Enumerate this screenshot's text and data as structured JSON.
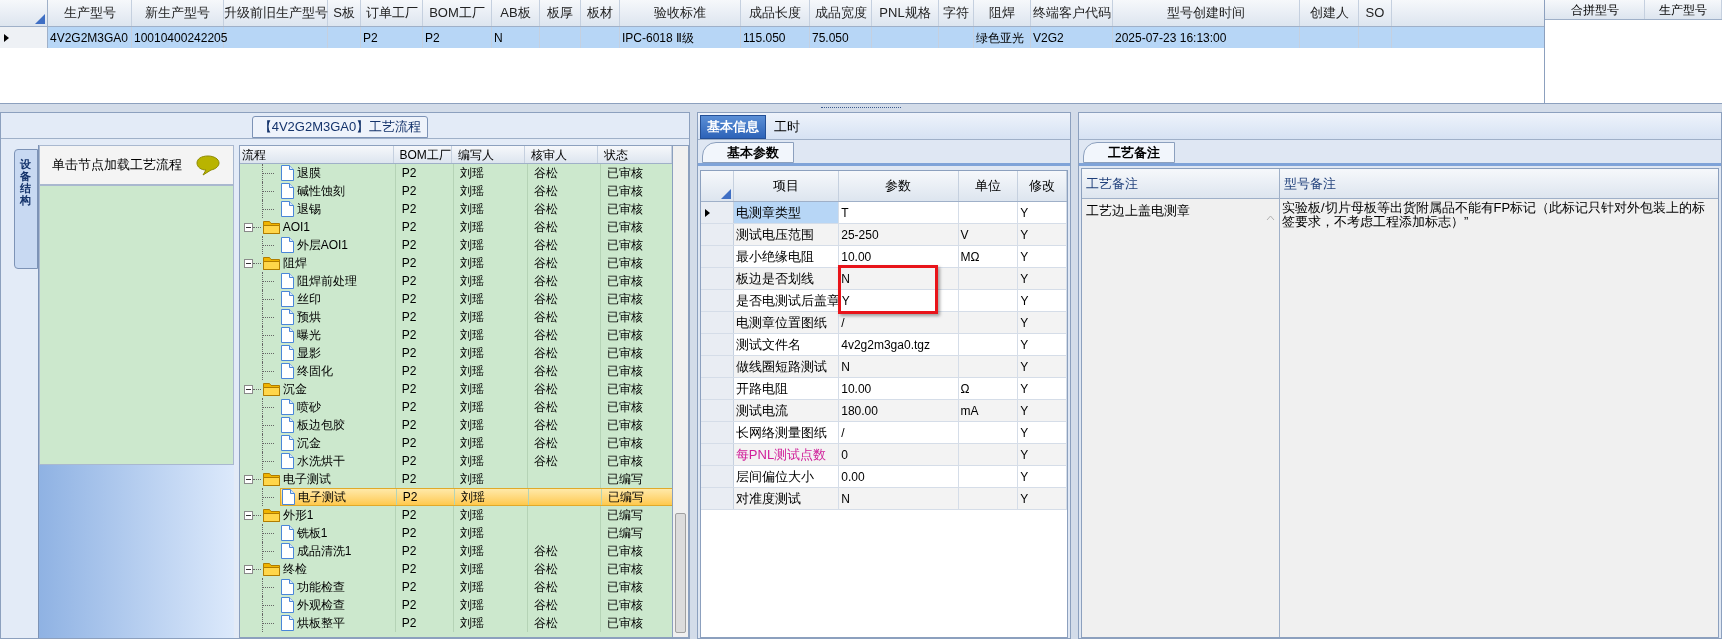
{
  "main_grid": {
    "columns": [
      "生产型号",
      "新生产型号",
      "升级前旧生产型号",
      "S板",
      "订单工厂",
      "BOM工厂",
      "AB板",
      "板厚",
      "板材",
      "验收标准",
      "成品长度",
      "成品宽度",
      "PNL规格",
      "字符",
      "阻焊",
      "终端客户代码",
      "型号创建时间",
      "创建人",
      "SO"
    ],
    "rows": [
      {
        "selected": true,
        "cells": [
          "4V2G2M3GA0",
          "10010400242205",
          null,
          null,
          "P2",
          "P2",
          "N",
          null,
          null,
          "IPC-6018 Ⅱ级",
          "115.050",
          "75.050",
          null,
          null,
          "绿色亚光",
          "V2G2",
          "2025-07-23 16:13:00",
          null,
          null
        ]
      }
    ]
  },
  "merge_grid": {
    "columns": [
      "合拼型号",
      "生产型号"
    ]
  },
  "process_panel": {
    "title": "【4V2G2M3GA0】工艺流程",
    "side_tab": "设备结构",
    "hint": "单击节点加载工艺流程",
    "columns": [
      "流程",
      "BOM工厂",
      "编写人",
      "核审人",
      "状态"
    ],
    "tree": [
      {
        "kind": "step",
        "name": "退膜",
        "bom": "P2",
        "author": "刘瑶",
        "reviewer": "谷松",
        "status": "已审核",
        "selected": false
      },
      {
        "kind": "step",
        "name": "碱性蚀刻",
        "bom": "P2",
        "author": "刘瑶",
        "reviewer": "谷松",
        "status": "已审核",
        "selected": false
      },
      {
        "kind": "step",
        "name": "退锡",
        "bom": "P2",
        "author": "刘瑶",
        "reviewer": "谷松",
        "status": "已审核",
        "selected": false
      },
      {
        "kind": "folder",
        "expanded": true,
        "name": "AOI1",
        "bom": "P2",
        "author": "刘瑶",
        "reviewer": "谷松",
        "status": "已审核",
        "selected": false,
        "children": [
          {
            "kind": "step",
            "name": "外层AOI1",
            "bom": "P2",
            "author": "刘瑶",
            "reviewer": "谷松",
            "status": "已审核",
            "selected": false
          }
        ]
      },
      {
        "kind": "folder",
        "expanded": true,
        "name": "阻焊",
        "bom": "P2",
        "author": "刘瑶",
        "reviewer": "谷松",
        "status": "已审核",
        "selected": false,
        "children": [
          {
            "kind": "step",
            "name": "阻焊前处理",
            "bom": "P2",
            "author": "刘瑶",
            "reviewer": "谷松",
            "status": "已审核",
            "selected": false
          },
          {
            "kind": "step",
            "name": "丝印",
            "bom": "P2",
            "author": "刘瑶",
            "reviewer": "谷松",
            "status": "已审核",
            "selected": false
          },
          {
            "kind": "step",
            "name": "预烘",
            "bom": "P2",
            "author": "刘瑶",
            "reviewer": "谷松",
            "status": "已审核",
            "selected": false
          },
          {
            "kind": "step",
            "name": "曝光",
            "bom": "P2",
            "author": "刘瑶",
            "reviewer": "谷松",
            "status": "已审核",
            "selected": false
          },
          {
            "kind": "step",
            "name": "显影",
            "bom": "P2",
            "author": "刘瑶",
            "reviewer": "谷松",
            "status": "已审核",
            "selected": false
          },
          {
            "kind": "step",
            "name": "终固化",
            "bom": "P2",
            "author": "刘瑶",
            "reviewer": "谷松",
            "status": "已审核",
            "selected": false
          }
        ]
      },
      {
        "kind": "folder",
        "expanded": true,
        "name": "沉金",
        "bom": "P2",
        "author": "刘瑶",
        "reviewer": "谷松",
        "status": "已审核",
        "selected": false,
        "children": [
          {
            "kind": "step",
            "name": "喷砂",
            "bom": "P2",
            "author": "刘瑶",
            "reviewer": "谷松",
            "status": "已审核",
            "selected": false
          },
          {
            "kind": "step",
            "name": "板边包胶",
            "bom": "P2",
            "author": "刘瑶",
            "reviewer": "谷松",
            "status": "已审核",
            "selected": false
          },
          {
            "kind": "step",
            "name": "沉金",
            "bom": "P2",
            "author": "刘瑶",
            "reviewer": "谷松",
            "status": "已审核",
            "selected": false
          },
          {
            "kind": "step",
            "name": "水洗烘干",
            "bom": "P2",
            "author": "刘瑶",
            "reviewer": "谷松",
            "status": "已审核",
            "selected": false
          }
        ]
      },
      {
        "kind": "folder",
        "expanded": true,
        "name": "电子测试",
        "bom": "P2",
        "author": "刘瑶",
        "status": "已编写",
        "selected": false,
        "children": [
          {
            "kind": "step",
            "name": "电子测试",
            "bom": "P2",
            "author": "刘瑶",
            "status": "已编写",
            "selected": true
          }
        ]
      },
      {
        "kind": "folder",
        "expanded": true,
        "name": "外形1",
        "bom": "P2",
        "author": "刘瑶",
        "status": "已编写",
        "selected": false,
        "children": [
          {
            "kind": "step",
            "name": "铣板1",
            "bom": "P2",
            "author": "刘瑶",
            "status": "已编写",
            "selected": false
          },
          {
            "kind": "step",
            "name": "成品清洗1",
            "bom": "P2",
            "author": "刘瑶",
            "reviewer": "谷松",
            "status": "已审核",
            "selected": false
          }
        ]
      },
      {
        "kind": "folder",
        "expanded": true,
        "name": "终检",
        "bom": "P2",
        "author": "刘瑶",
        "reviewer": "谷松",
        "status": "已审核",
        "selected": false,
        "children": [
          {
            "kind": "step",
            "name": "功能检查",
            "bom": "P2",
            "author": "刘瑶",
            "reviewer": "谷松",
            "status": "已审核",
            "selected": false
          },
          {
            "kind": "step",
            "name": "外观检查",
            "bom": "P2",
            "author": "刘瑶",
            "reviewer": "谷松",
            "status": "已审核",
            "selected": false
          },
          {
            "kind": "step",
            "name": "烘板整平",
            "bom": "P2",
            "author": "刘瑶",
            "reviewer": "谷松",
            "status": "已审核",
            "selected": false
          }
        ]
      }
    ]
  },
  "info_tabs": [
    {
      "label": "基本信息",
      "selected": true
    },
    {
      "label": "工时",
      "selected": false
    }
  ],
  "params": {
    "tab": "基本参数",
    "columns": [
      "项目",
      "参数",
      "单位",
      "修改"
    ],
    "rows": [
      {
        "item": "电测章类型",
        "value": "T",
        "modify": "Y",
        "current": true,
        "warning": false
      },
      {
        "item": "测试电压范围",
        "value": "25-250",
        "unit": "V",
        "modify": "Y",
        "current": false,
        "warning": false
      },
      {
        "item": "最小绝缘电阻",
        "value": "10.00",
        "unit": "MΩ",
        "modify": "Y",
        "current": false,
        "warning": false
      },
      {
        "item": "板边是否划线",
        "value": "N",
        "modify": "Y",
        "current": false,
        "warning": false
      },
      {
        "item": "是否电测试后盖章",
        "value": "Y",
        "modify": "Y",
        "current": false,
        "warning": false
      },
      {
        "item": "电测章位置图纸",
        "value": "/",
        "modify": "Y",
        "current": false,
        "warning": false
      },
      {
        "item": "测试文件名",
        "value": "4v2g2m3ga0.tgz",
        "modify": "Y",
        "current": false,
        "warning": false
      },
      {
        "item": "做线圈短路测试",
        "value": "N",
        "modify": "Y",
        "current": false,
        "warning": false
      },
      {
        "item": "开路电阻",
        "value": "10.00",
        "unit": "Ω",
        "modify": "Y",
        "current": false,
        "warning": false
      },
      {
        "item": "测试电流",
        "value": "180.00",
        "unit": "mA",
        "modify": "Y",
        "current": false,
        "warning": false
      },
      {
        "item": "长网络测量图纸",
        "value": "/",
        "modify": "Y",
        "current": false,
        "warning": false
      },
      {
        "item": "每PNL测试点数",
        "value": "0",
        "modify": "Y",
        "current": false,
        "warning": true
      },
      {
        "item": "层间偏位大小",
        "value": "0.00",
        "modify": "Y",
        "current": false,
        "warning": false
      },
      {
        "item": "对准度测试",
        "value": "N",
        "modify": "Y",
        "current": false,
        "warning": false
      }
    ],
    "annotation": {
      "kind": "rectangle"
    }
  },
  "notes": {
    "tab": "工艺备注",
    "columns": [
      "工艺备注",
      "型号备注"
    ],
    "process_note": "工艺边上盖电测章",
    "model_note": "实验板/切片母板等出货附属品不能有FP标记（此标记只针对外包装上的标签要求，不考虑工程添加标志）”"
  }
}
